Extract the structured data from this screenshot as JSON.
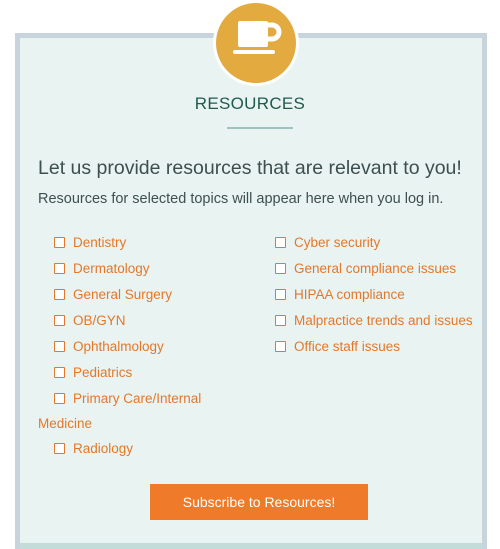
{
  "panel": {
    "title": "RESOURCES",
    "headline": "Let us provide resources that are relevant to you!",
    "subline": "Resources for selected topics will appear here when you log in."
  },
  "topics_left": [
    {
      "label": "Dentistry",
      "checked": false
    },
    {
      "label": "Dermatology",
      "checked": false
    },
    {
      "label": "General Surgery",
      "checked": false
    },
    {
      "label": "OB/GYN",
      "checked": false
    },
    {
      "label": "Ophthalmology",
      "checked": false
    },
    {
      "label": "Pediatrics",
      "checked": false
    },
    {
      "label": "Primary Care/Internal",
      "checked": false
    },
    {
      "label": "Radiology",
      "checked": false
    }
  ],
  "topic_wrap": "Medicine",
  "topics_right": [
    {
      "label": "Cyber security",
      "checked": false
    },
    {
      "label": "General compliance issues",
      "checked": false
    },
    {
      "label": "HIPAA compliance",
      "checked": false
    },
    {
      "label": "Malpractice trends and issues",
      "checked": false
    },
    {
      "label": "Office staff issues",
      "checked": false
    }
  ],
  "subscribe_label": "Subscribe to Resources!",
  "icons": {
    "header": "coffee-cup-icon",
    "checkbox": "checkbox-icon"
  },
  "colors": {
    "accent": "#ee7a2a",
    "badge": "#e3aa3f",
    "title": "#1e5b4a",
    "panel": "#e9f3f1"
  }
}
